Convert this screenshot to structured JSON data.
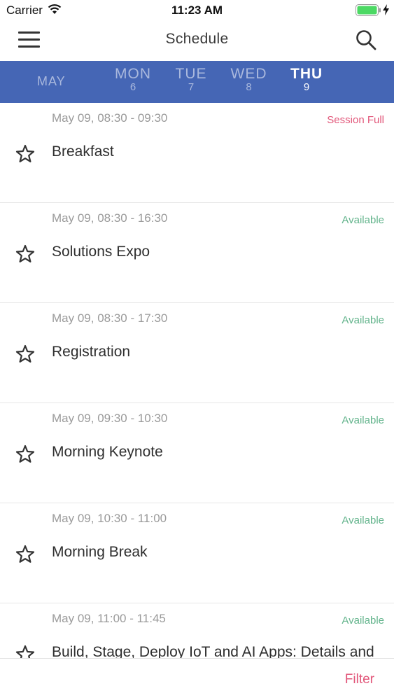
{
  "status_bar": {
    "carrier": "Carrier",
    "time": "11:23 AM"
  },
  "nav": {
    "title": "Schedule",
    "menu_icon": "hamburger-menu-icon",
    "search_icon": "search-icon"
  },
  "days": {
    "month": "MAY",
    "items": [
      {
        "name": "MON",
        "number": "6",
        "active": false
      },
      {
        "name": "TUE",
        "number": "7",
        "active": false
      },
      {
        "name": "WED",
        "number": "8",
        "active": false
      },
      {
        "name": "THU",
        "number": "9",
        "active": true
      }
    ]
  },
  "sessions": [
    {
      "time": "May 09,  08:30 - 09:30",
      "status": "Session Full",
      "status_type": "full",
      "title": "Breakfast"
    },
    {
      "time": "May 09,  08:30 - 16:30",
      "status": "Available",
      "status_type": "avail",
      "title": "Solutions Expo"
    },
    {
      "time": "May 09,  08:30 - 17:30",
      "status": "Available",
      "status_type": "avail",
      "title": "Registration"
    },
    {
      "time": "May 09,  09:30 - 10:30",
      "status": "Available",
      "status_type": "avail",
      "title": "Morning Keynote"
    },
    {
      "time": "May 09,  10:30 - 11:00",
      "status": "Available",
      "status_type": "avail",
      "title": "Morning Break"
    },
    {
      "time": "May 09,  11:00 - 11:45",
      "status": "Available",
      "status_type": "avail",
      "title": "Build, Stage, Deploy IoT and AI Apps: Details and a Case Study"
    }
  ],
  "bottom_bar": {
    "filter_label": "Filter"
  },
  "colors": {
    "day_bar": "#4566b5",
    "session_full": "#e2577a",
    "available": "#63b48c",
    "filter": "#e2577a"
  }
}
